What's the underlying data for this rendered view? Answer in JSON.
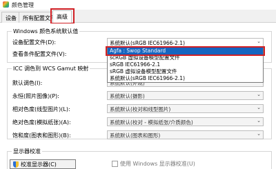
{
  "window": {
    "title": "颜色管理"
  },
  "tabs": [
    {
      "label": "设备"
    },
    {
      "label": "所有配置文件"
    },
    {
      "label": "高级"
    }
  ],
  "windows_defaults": {
    "heading": "Windows 颜色系统默认值",
    "device_profile": {
      "label": "设备配置文件(D):",
      "value": "系统默认(sRGB IEC61966-2.1)"
    },
    "viewing_conditions": {
      "label": "查看条件配置文件(V):"
    },
    "dropdown_options": [
      "Agfa : Swop Standard",
      "scRGB 虚拟设备模型配置文件",
      "sRGB IEC61966-2.1",
      "sRGB 虚拟设备模型配置文件",
      "系统默认(sRGB IEC61966-2.1)"
    ]
  },
  "icc_mapping": {
    "heading": "ICC 调色到 WCS Gamut 映射",
    "rows": [
      {
        "label": "默认调色(I):",
        "value": "系统默认(外观)"
      },
      {
        "label": "永恒(照片图像)(P):",
        "value": "系统默认(摄影)"
      },
      {
        "label": "相对色度(线型图片)(L):",
        "value": "系统默认(校对和线型图片)"
      },
      {
        "label": "绝对色度(模拟纸张)(A):",
        "value": "系统默认(校对 - 模拟纸张/介质颜色)"
      },
      {
        "label": "饱和度(图表和图形)(B):",
        "value": "系统默认(图表和图形)"
      }
    ]
  },
  "calibration": {
    "heading": "显示器校准",
    "button_label": "校准显示器(C)",
    "checkbox_label": "使用 Windows 显示器校准(U)"
  }
}
